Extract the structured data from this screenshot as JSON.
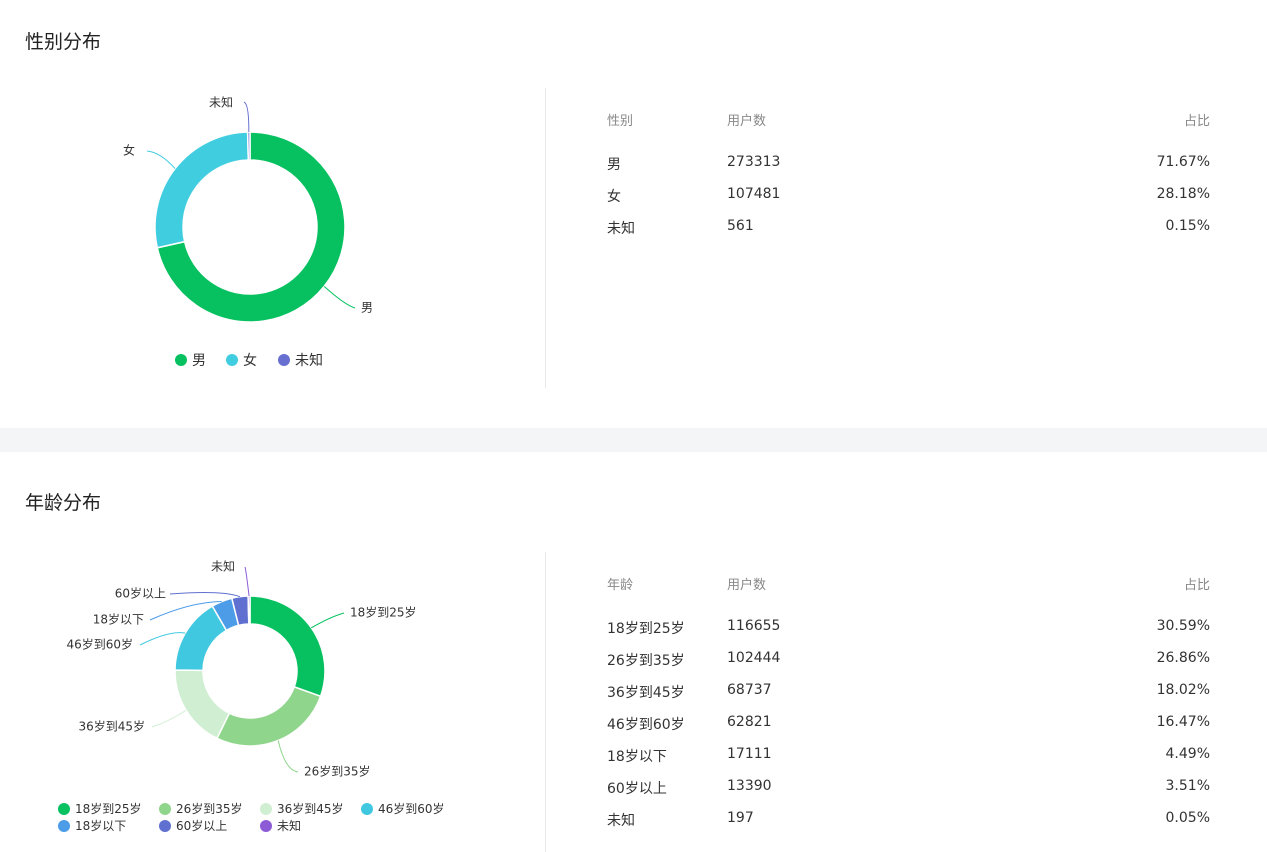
{
  "gender": {
    "title": "性别分布",
    "table": {
      "headers": [
        "性别",
        "用户数",
        "占比"
      ],
      "rows": [
        [
          "男",
          "273313",
          "71.67%"
        ],
        [
          "女",
          "107481",
          "28.18%"
        ],
        [
          "未知",
          "561",
          "0.15%"
        ]
      ]
    }
  },
  "age": {
    "title": "年龄分布",
    "table": {
      "headers": [
        "年龄",
        "用户数",
        "占比"
      ],
      "rows": [
        [
          "18岁到25岁",
          "116655",
          "30.59%"
        ],
        [
          "26岁到35岁",
          "102444",
          "26.86%"
        ],
        [
          "36岁到45岁",
          "68737",
          "18.02%"
        ],
        [
          "46岁到60岁",
          "62821",
          "16.47%"
        ],
        [
          "18岁以下",
          "17111",
          "4.49%"
        ],
        [
          "60岁以上",
          "13390",
          "3.51%"
        ],
        [
          "未知",
          "197",
          "0.05%"
        ]
      ]
    }
  },
  "chart_data": [
    {
      "type": "pie",
      "categories": [
        "男",
        "女",
        "未知"
      ],
      "values": [
        273313,
        107481,
        561
      ],
      "colors": [
        "#07c160",
        "#40cde0",
        "#6770d0"
      ],
      "legend": "bottom",
      "legend_labels": [
        "男",
        "女",
        "未知"
      ]
    },
    {
      "type": "pie",
      "categories": [
        "18岁到25岁",
        "26岁到35岁",
        "36岁到45岁",
        "46岁到60岁",
        "18岁以下",
        "60岁以上",
        "未知"
      ],
      "values": [
        116655,
        102444,
        68737,
        62821,
        17111,
        13390,
        197
      ],
      "colors": [
        "#07c160",
        "#8fd68c",
        "#d0efd2",
        "#40c8e0",
        "#4c9ce8",
        "#6070d0",
        "#8c5cd6"
      ],
      "legend": "bottom",
      "legend_labels": [
        "18岁到25岁",
        "26岁到35岁",
        "36岁到45岁",
        "46岁到60岁",
        "18岁以下",
        "60岁以上",
        "未知"
      ]
    }
  ]
}
